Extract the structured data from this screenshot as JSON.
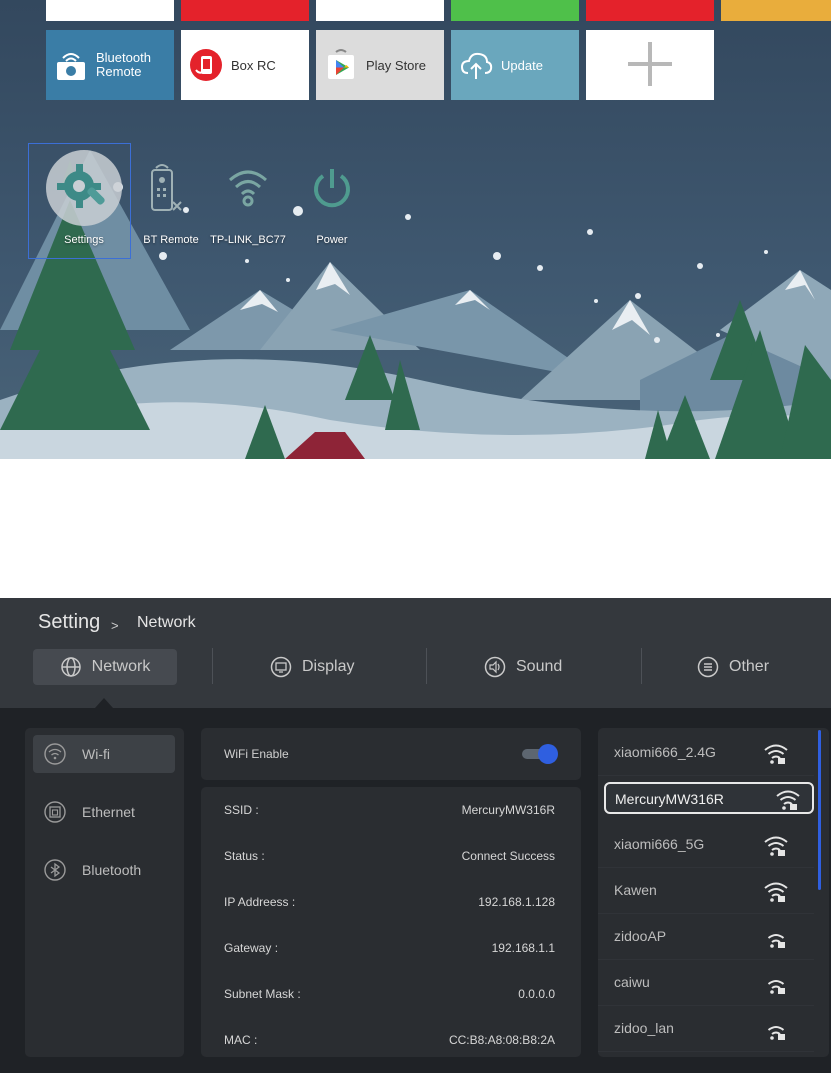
{
  "launcher": {
    "tiles": [
      {
        "label_line1": "Bluetooth",
        "label_line2": "Remote",
        "icon": "bluetooth-remote-icon"
      },
      {
        "label": "Box RC",
        "icon": "box-rc-icon"
      },
      {
        "label": "Play Store",
        "icon": "play-store-icon"
      },
      {
        "label": "Update",
        "icon": "cloud-upload-icon"
      },
      {
        "label": "",
        "icon": "add-icon"
      }
    ],
    "shortcuts": [
      {
        "label": "Settings",
        "icon": "settings-icon"
      },
      {
        "label": "BT Remote",
        "icon": "remote-icon"
      },
      {
        "label": "TP-LINK_BC77",
        "icon": "wifi-icon"
      },
      {
        "label": "Power",
        "icon": "power-icon"
      }
    ]
  },
  "settings": {
    "breadcrumb": {
      "root": "Setting",
      "separator": ">",
      "leaf": "Network"
    },
    "tabs": [
      {
        "label": "Network",
        "icon": "globe-icon",
        "selected": true
      },
      {
        "label": "Display",
        "icon": "display-icon",
        "selected": false
      },
      {
        "label": "Sound",
        "icon": "speaker-icon",
        "selected": false
      },
      {
        "label": "Other",
        "icon": "menu-icon",
        "selected": false
      }
    ],
    "sidebar": [
      {
        "label": "Wi-fi",
        "icon": "wifi-icon",
        "selected": true
      },
      {
        "label": "Ethernet",
        "icon": "ethernet-icon",
        "selected": false
      },
      {
        "label": "Bluetooth",
        "icon": "bluetooth-icon",
        "selected": false
      }
    ],
    "wifi_enable": {
      "label": "WiFi Enable",
      "enabled": true
    },
    "details": [
      {
        "key": "SSID :",
        "value": "MercuryMW316R"
      },
      {
        "key": "Status :",
        "value": "Connect Success"
      },
      {
        "key": "IP Addreess :",
        "value": "192.168.1.128"
      },
      {
        "key": "Gateway :",
        "value": "192.168.1.1"
      },
      {
        "key": "Subnet Mask :",
        "value": "0.0.0.0"
      },
      {
        "key": "MAC :",
        "value": "CC:B8:A8:08:B8:2A"
      }
    ],
    "networks": [
      {
        "name": "xiaomi666_2.4G",
        "selected": false
      },
      {
        "name": "MercuryMW316R",
        "selected": true
      },
      {
        "name": "xiaomi666_5G",
        "selected": false
      },
      {
        "name": "Kawen",
        "selected": false
      },
      {
        "name": "zidooAP",
        "selected": false
      },
      {
        "name": "caiwu",
        "selected": false
      },
      {
        "name": "zidoo_lan",
        "selected": false
      }
    ],
    "colors": {
      "accent": "#2f5fe0",
      "background": "#1f2226",
      "header": "#34383d"
    }
  }
}
